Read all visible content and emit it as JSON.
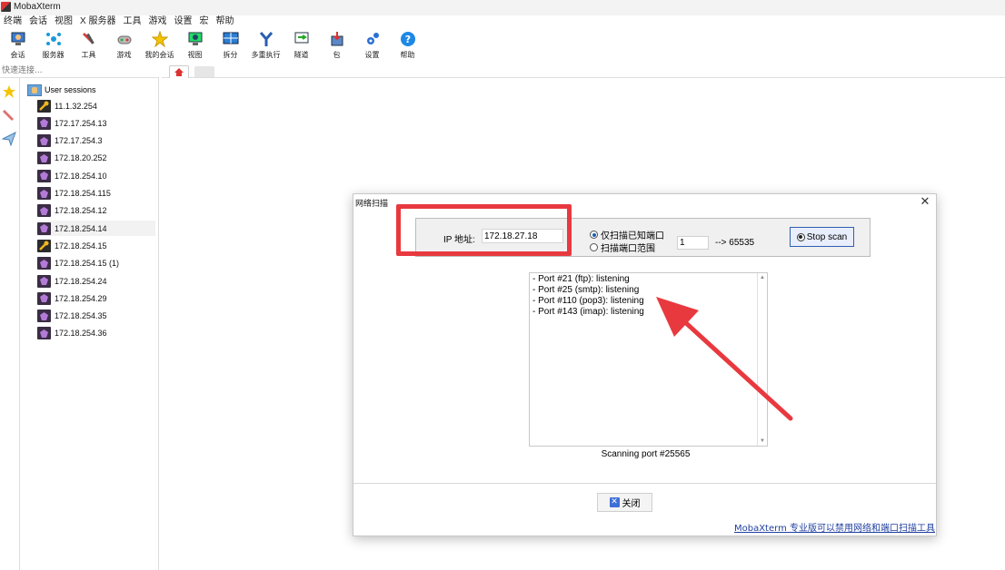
{
  "app": {
    "title": "MobaXterm"
  },
  "menu": [
    "终端",
    "会话",
    "视图",
    "X 服务器",
    "工具",
    "游戏",
    "设置",
    "宏",
    "帮助"
  ],
  "toolbar": [
    {
      "label": "会话",
      "icon": "session-icon"
    },
    {
      "label": "服务器",
      "icon": "servers-icon"
    },
    {
      "label": "工具",
      "icon": "tools-icon"
    },
    {
      "label": "游戏",
      "icon": "games-icon"
    },
    {
      "label": "我的会话",
      "icon": "star-icon"
    },
    {
      "label": "视图",
      "icon": "view-icon"
    },
    {
      "label": "拆分",
      "icon": "split-icon"
    },
    {
      "label": "多重执行",
      "icon": "multiexec-icon"
    },
    {
      "label": "隧道",
      "icon": "tunnel-icon"
    },
    {
      "label": "包",
      "icon": "packages-icon"
    },
    {
      "label": "设置",
      "icon": "settings-icon"
    },
    {
      "label": "帮助",
      "icon": "help-icon"
    }
  ],
  "quick_connect": {
    "placeholder": "快速连接..."
  },
  "sessions": {
    "root": "User sessions",
    "items": [
      {
        "label": "11.1.32.254",
        "type": "key"
      },
      {
        "label": "172.17.254.13",
        "type": "gem"
      },
      {
        "label": "172.17.254.3",
        "type": "gem"
      },
      {
        "label": "172.18.20.252",
        "type": "gem"
      },
      {
        "label": "172.18.254.10",
        "type": "gem"
      },
      {
        "label": "172.18.254.115",
        "type": "gem"
      },
      {
        "label": "172.18.254.12",
        "type": "gem"
      },
      {
        "label": "172.18.254.14",
        "type": "gem",
        "selected": true
      },
      {
        "label": "172.18.254.15",
        "type": "key"
      },
      {
        "label": "172.18.254.15 (1)",
        "type": "gem"
      },
      {
        "label": "172.18.254.24",
        "type": "gem"
      },
      {
        "label": "172.18.254.29",
        "type": "gem"
      },
      {
        "label": "172.18.254.35",
        "type": "gem"
      },
      {
        "label": "172.18.254.36",
        "type": "gem"
      }
    ]
  },
  "dialog": {
    "title": "网络扫描",
    "ip_label": "IP 地址:",
    "ip_value": "172.18.27.18",
    "radio_known": "仅扫描已知端口",
    "radio_range": "扫描端口范围",
    "port_from": "1",
    "port_to": "--> 65535",
    "stop_label": "Stop scan",
    "results": [
      "- Port #21 (ftp):  listening",
      "- Port #25 (smtp):  listening",
      "- Port #110 (pop3):  listening",
      "- Port #143 (imap):  listening"
    ],
    "status": "Scanning port #25565",
    "close_label": "关闭",
    "footer_link": "MobaXterm 专业版可以禁用网络和端口扫描工具"
  },
  "colors": {
    "annotation": "#e8393f",
    "accent": "#2f5fb0"
  }
}
